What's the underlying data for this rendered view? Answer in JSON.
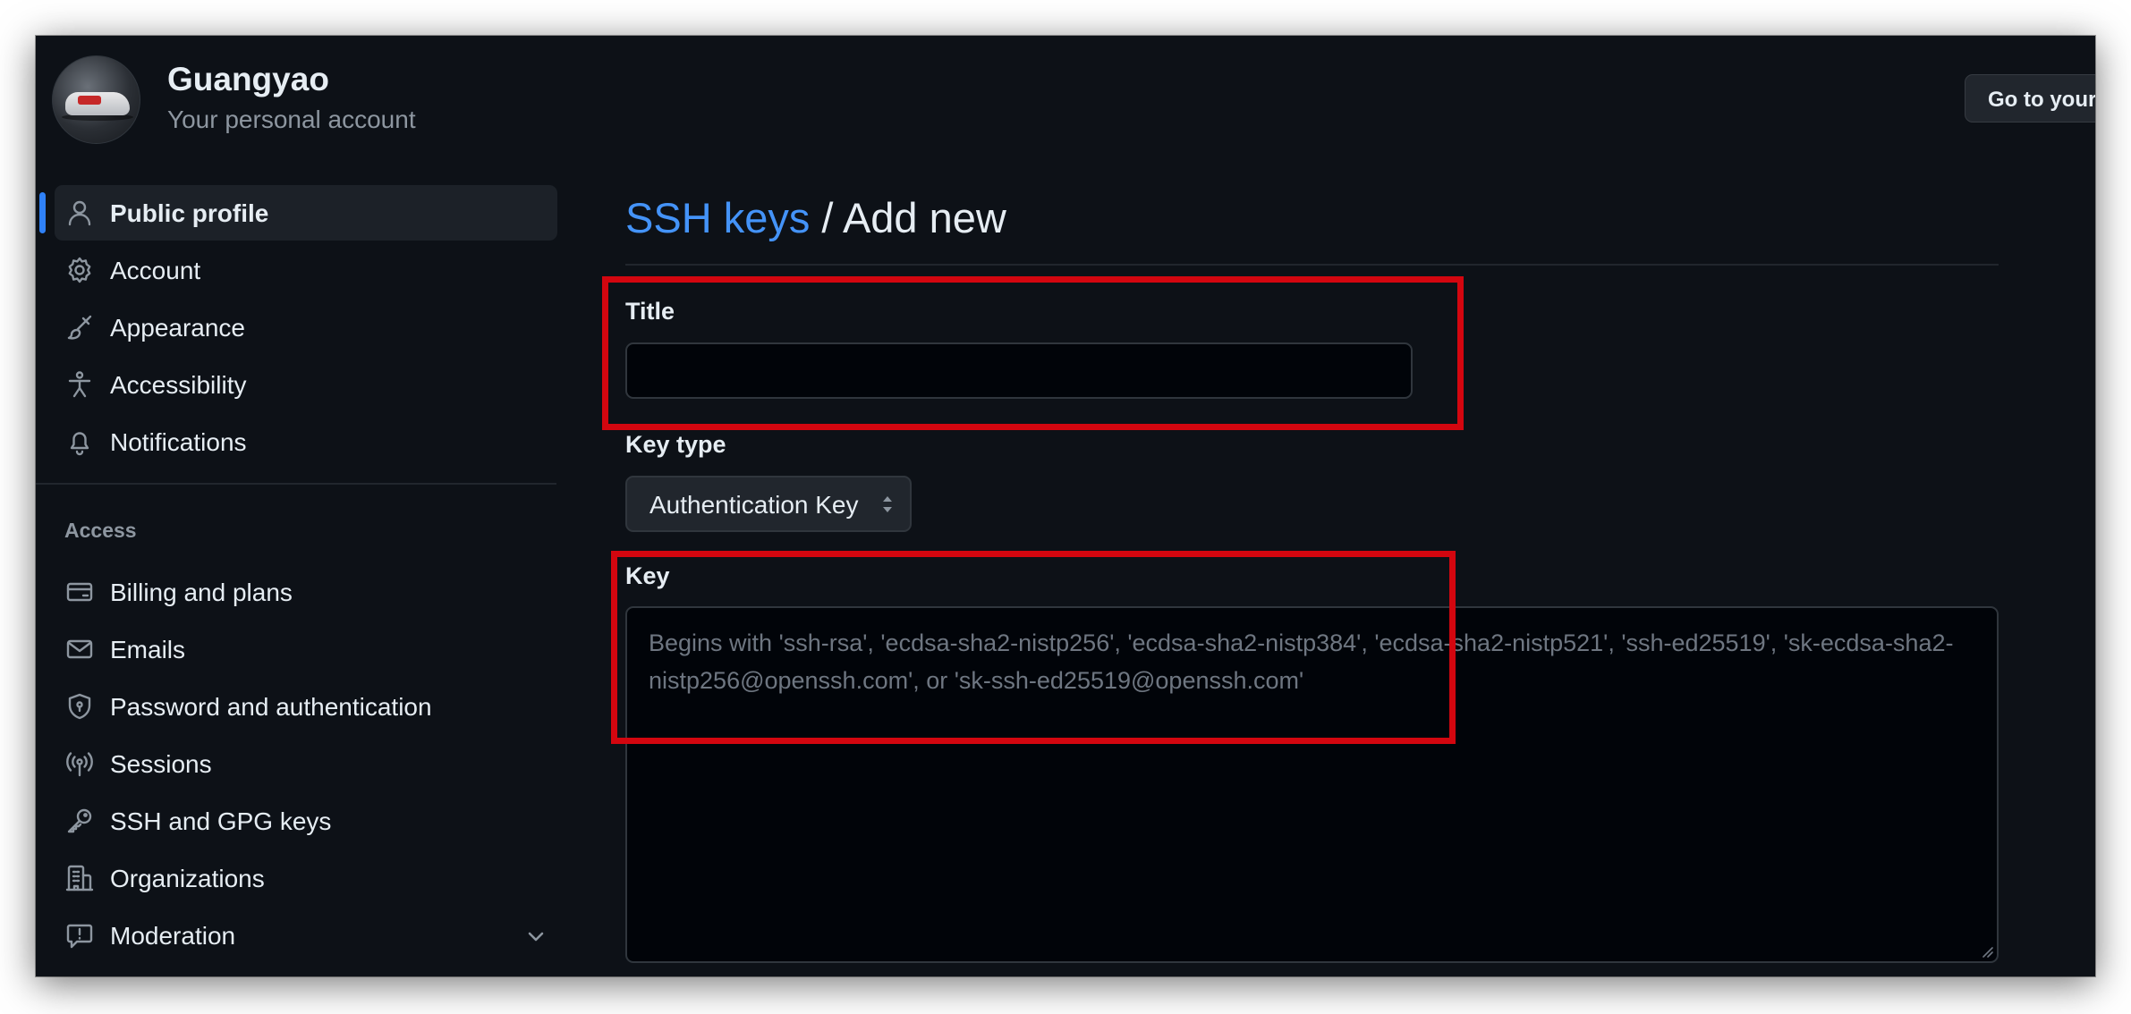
{
  "header": {
    "user_name": "Guangyao",
    "user_subtitle": "Your personal account",
    "goto_button": "Go to your"
  },
  "sidebar": {
    "items": [
      {
        "label": "Public profile",
        "icon": "person-icon",
        "active": true
      },
      {
        "label": "Account",
        "icon": "gear-icon"
      },
      {
        "label": "Appearance",
        "icon": "paintbrush-icon"
      },
      {
        "label": "Accessibility",
        "icon": "accessibility-icon"
      },
      {
        "label": "Notifications",
        "icon": "bell-icon"
      }
    ],
    "access_section": {
      "title": "Access",
      "items": [
        {
          "label": "Billing and plans",
          "icon": "credit-card-icon"
        },
        {
          "label": "Emails",
          "icon": "mail-icon"
        },
        {
          "label": "Password and authentication",
          "icon": "shield-lock-icon"
        },
        {
          "label": "Sessions",
          "icon": "broadcast-icon"
        },
        {
          "label": "SSH and GPG keys",
          "icon": "key-icon"
        },
        {
          "label": "Organizations",
          "icon": "organization-icon"
        },
        {
          "label": "Moderation",
          "icon": "report-icon",
          "expandable": true
        }
      ]
    }
  },
  "main": {
    "breadcrumb": {
      "link": "SSH keys",
      "separator": " / ",
      "current": "Add new"
    },
    "title_field": {
      "label": "Title",
      "value": "",
      "placeholder": ""
    },
    "key_type_field": {
      "label": "Key type",
      "selected": "Authentication Key"
    },
    "key_field": {
      "label": "Key",
      "value": "",
      "placeholder": "Begins with 'ssh-rsa', 'ecdsa-sha2-nistp256', 'ecdsa-sha2-nistp384', 'ecdsa-sha2-nistp521', 'ssh-ed25519', 'sk-ecdsa-sha2-nistp256@openssh.com', or 'sk-ssh-ed25519@openssh.com'"
    }
  },
  "colors": {
    "background": "#0d1117",
    "accent_link": "#4493f8",
    "active_indicator": "#2f81f7",
    "highlight_annotation": "#d3060f"
  }
}
